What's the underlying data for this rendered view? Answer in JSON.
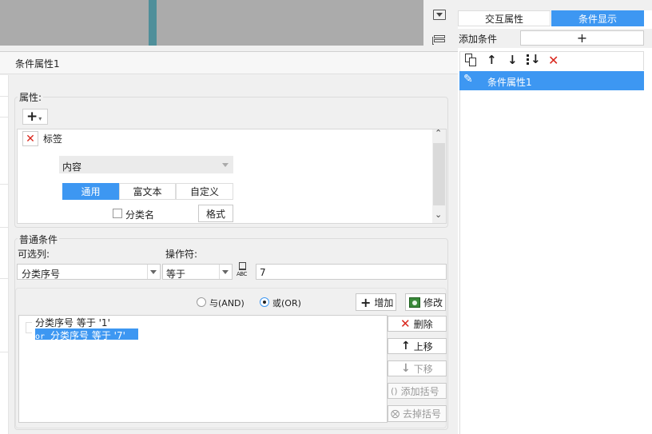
{
  "dialog": {
    "title": "条件属性1"
  },
  "property": {
    "section_label": "属性:",
    "add_symbol": "+",
    "item_label": "标签",
    "content_select": "内容",
    "tabs": [
      "通用",
      "富文本",
      "自定义"
    ],
    "category_checkbox_label": "分类名",
    "format_button": "格式"
  },
  "normal_condition": {
    "section_label": "普通条件",
    "column_label": "可选列:",
    "operator_label": "操作符:",
    "column_value": "分类序号",
    "operator_value": "等于",
    "abc_icon_text": "ABC",
    "value_input": "7",
    "radio_and": "与(AND)",
    "radio_or": "或(OR)",
    "add_button": "增加",
    "modify_button": "修改",
    "conditions": [
      {
        "prefix": "",
        "text": "分类序号 等于 '1'"
      },
      {
        "prefix": "or",
        "text": "分类序号 等于 '7'"
      }
    ],
    "delete_button": "删除",
    "move_up_button": "上移",
    "move_down_button": "下移",
    "add_bracket_button": "添加括号",
    "remove_bracket_button": "去掉括号"
  },
  "right_panel": {
    "tab_interaction": "交互属性",
    "tab_condition_display": "条件显示",
    "add_condition_label": "添加条件",
    "add_condition_symbol": "+",
    "list_items": [
      "条件属性1"
    ]
  },
  "colors": {
    "accent": "#3d97f2",
    "teal_bar": "#4f8f9a",
    "delete_red": "#d9261c"
  }
}
